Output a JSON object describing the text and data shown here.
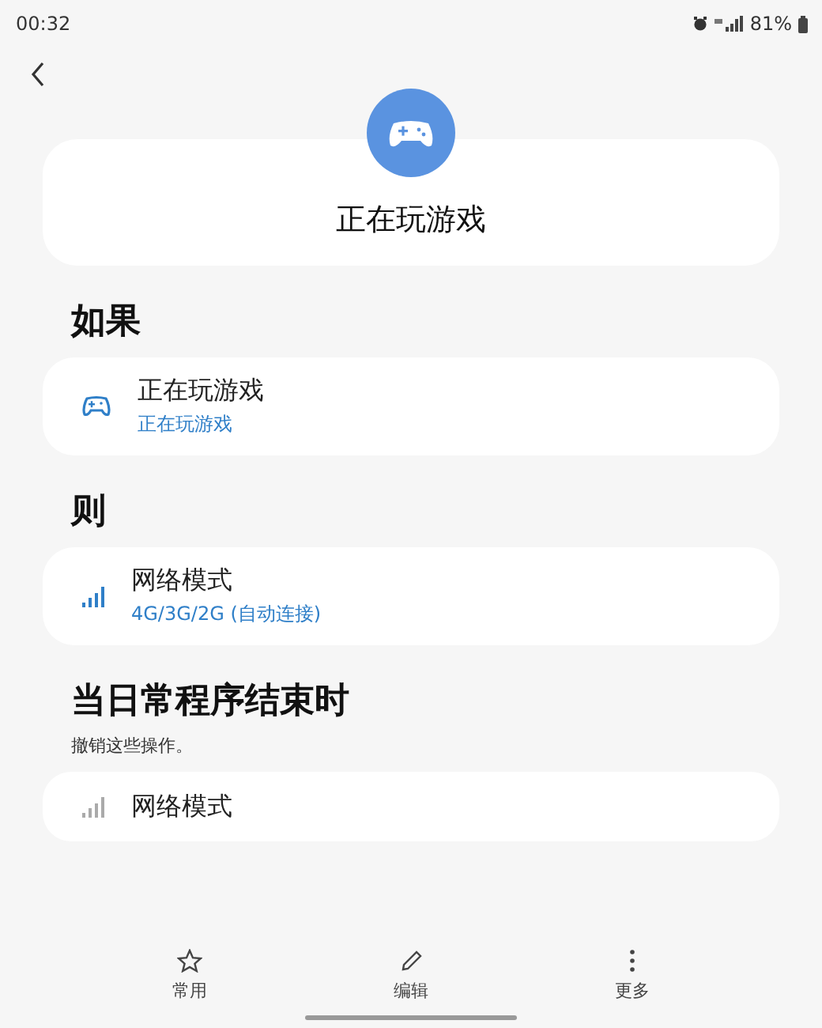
{
  "status_bar": {
    "time": "00:32",
    "battery": "81%"
  },
  "header": {
    "title": "正在玩游戏"
  },
  "sections": [
    {
      "heading": "如果",
      "items": [
        {
          "kind": "gamepad",
          "title": "正在玩游戏",
          "subtitle": "正在玩游戏",
          "dimmed": false
        }
      ]
    },
    {
      "heading": "则",
      "items": [
        {
          "kind": "signal",
          "title": "网络模式",
          "subtitle": "4G/3G/2G (自动连接)",
          "dimmed": false
        }
      ]
    },
    {
      "heading": "当日常程序结束时",
      "note": "撤销这些操作。",
      "items": [
        {
          "kind": "signal",
          "title": "网络模式",
          "dimmed": true
        }
      ]
    }
  ],
  "bottom_nav": [
    {
      "kind": "star",
      "label": "常用"
    },
    {
      "kind": "pencil",
      "label": "编辑"
    },
    {
      "kind": "more",
      "label": "更多"
    }
  ]
}
